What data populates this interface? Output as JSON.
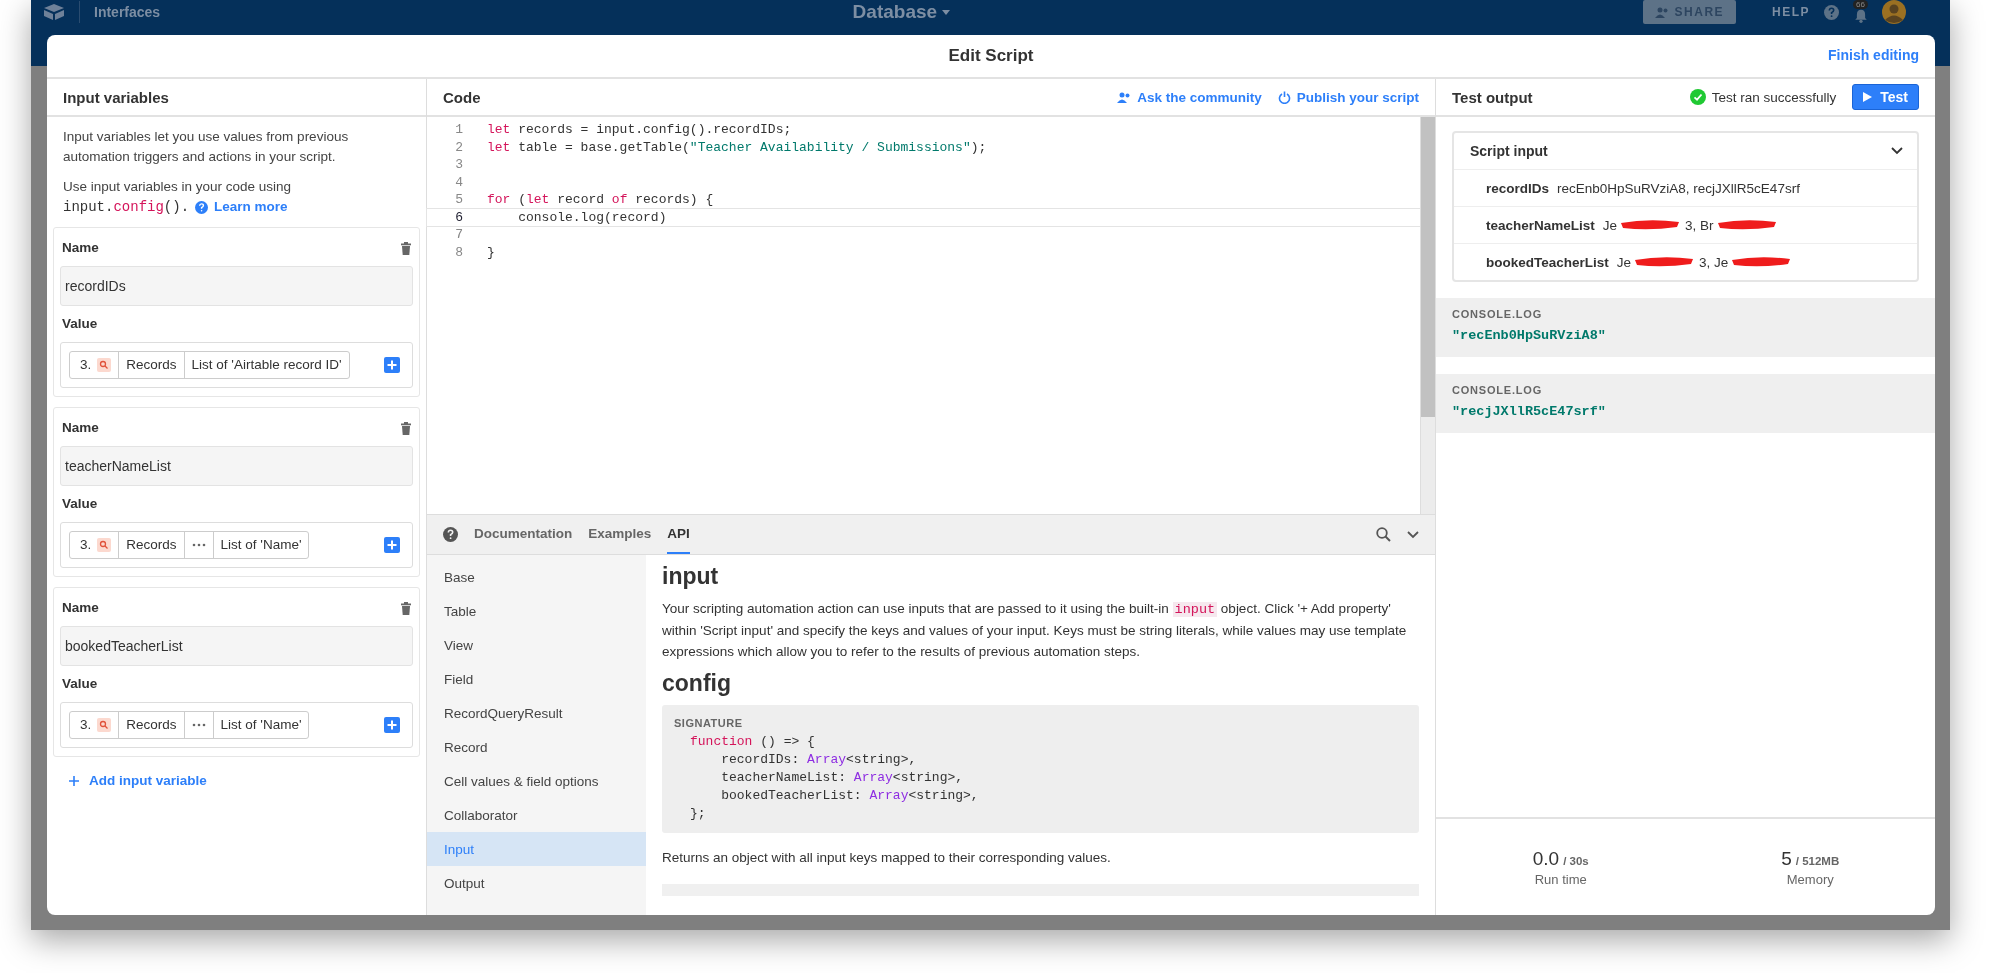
{
  "top_bar": {
    "left_label": "Interfaces",
    "title": "Database",
    "share": "SHARE",
    "help": "HELP",
    "notifications": "66"
  },
  "modal": {
    "title": "Edit Script",
    "finish": "Finish editing"
  },
  "input_panel": {
    "title": "Input variables",
    "intro": "Input variables let you use values from previous automation triggers and actions in your script.",
    "usage": {
      "text": "Use input variables in your code using",
      "code": [
        {
          "t": "input.",
          "kind": "plain"
        },
        {
          "t": "config",
          "kind": "kw"
        },
        {
          "t": "().",
          "kind": "plain"
        }
      ],
      "link": "Learn more"
    },
    "variables": [
      {
        "name_label": "Name",
        "name": "recordIDs",
        "value_label": "Value",
        "pills": [
          {
            "kind": "step",
            "text": "3."
          },
          {
            "kind": "text",
            "text": "Records"
          },
          {
            "kind": "text",
            "text": "List of 'Airtable record ID'"
          }
        ]
      },
      {
        "name_label": "Name",
        "name": "teacherNameList",
        "value_label": "Value",
        "pills": [
          {
            "kind": "step",
            "text": "3."
          },
          {
            "kind": "text",
            "text": "Records"
          },
          {
            "kind": "more"
          },
          {
            "kind": "text",
            "text": "List of 'Name'"
          }
        ]
      },
      {
        "name_label": "Name",
        "name": "bookedTeacherList",
        "value_label": "Value",
        "pills": [
          {
            "kind": "step",
            "text": "3."
          },
          {
            "kind": "text",
            "text": "Records"
          },
          {
            "kind": "more"
          },
          {
            "kind": "text",
            "text": "List of 'Name'"
          }
        ]
      }
    ],
    "add_variable": "Add input variable"
  },
  "code": {
    "title": "Code",
    "links": [
      "Ask the community",
      "Publish your script"
    ],
    "lines": [
      {
        "number": "1",
        "active": false,
        "tokens": [
          {
            "t": "let",
            "kind": "kw"
          },
          {
            "t": " records = input.config().recordIDs;",
            "kind": "plain"
          }
        ]
      },
      {
        "number": "2",
        "active": false,
        "tokens": [
          {
            "t": "let",
            "kind": "kw"
          },
          {
            "t": " table = base.getTable(",
            "kind": "plain"
          },
          {
            "t": "\"Teacher Availability / Submissions\"",
            "kind": "str"
          },
          {
            "t": ");",
            "kind": "plain"
          }
        ]
      },
      {
        "number": "3",
        "active": false
      },
      {
        "number": "4",
        "active": false
      },
      {
        "number": "5",
        "active": false,
        "tokens": [
          {
            "t": "for",
            "kind": "kw"
          },
          {
            "t": " (",
            "kind": "plain"
          },
          {
            "t": "let",
            "kind": "kw"
          },
          {
            "t": " record ",
            "kind": "plain"
          },
          {
            "t": "of",
            "kind": "kw"
          },
          {
            "t": " records) {",
            "kind": "plain"
          }
        ]
      },
      {
        "number": "6",
        "active": true,
        "tokens": [
          {
            "t": "    console.log(record)",
            "kind": "plain"
          }
        ]
      },
      {
        "number": "7",
        "active": false
      },
      {
        "number": "8",
        "active": false,
        "tokens": [
          {
            "t": "}",
            "kind": "plain"
          }
        ]
      }
    ]
  },
  "docs": {
    "tabs": [
      {
        "label": "Documentation",
        "selected": false
      },
      {
        "label": "Examples",
        "selected": false
      },
      {
        "label": "API",
        "selected": true
      }
    ],
    "nav": [
      {
        "label": "Base",
        "selected": false
      },
      {
        "label": "Table",
        "selected": false
      },
      {
        "label": "View",
        "selected": false
      },
      {
        "label": "Field",
        "selected": false
      },
      {
        "label": "RecordQueryResult",
        "selected": false
      },
      {
        "label": "Record",
        "selected": false
      },
      {
        "label": "Cell values & field options",
        "selected": false
      },
      {
        "label": "Collaborator",
        "selected": false
      },
      {
        "label": "Input",
        "selected": true
      },
      {
        "label": "Output",
        "selected": false
      }
    ],
    "heading": "input",
    "paragraph": {
      "before": "Your scripting automation action can use inputs that are passed to it using the built-in",
      "code": "input",
      "after": "object. Click '+ Add property' within 'Script input' and specify the keys and values of your input. Keys must be string literals, while values may use template expressions which allow you to refer to the results of previous automation steps."
    },
    "subheading": "config",
    "signature_label": "SIGNATURE",
    "signature_lines": [
      [
        {
          "t": "function",
          "kind": "kw"
        },
        {
          "t": " () => {",
          "kind": "plain"
        }
      ],
      [
        {
          "t": "    recordIDs: ",
          "kind": "plain"
        },
        {
          "t": "Array",
          "kind": "type"
        },
        {
          "t": "<string>,",
          "kind": "plain"
        }
      ],
      [
        {
          "t": "    teacherNameList: ",
          "kind": "plain"
        },
        {
          "t": "Array",
          "kind": "type"
        },
        {
          "t": "<string>,",
          "kind": "plain"
        }
      ],
      [
        {
          "t": "    bookedTeacherList: ",
          "kind": "plain"
        },
        {
          "t": "Array",
          "kind": "type"
        },
        {
          "t": "<string>,",
          "kind": "plain"
        }
      ],
      [
        {
          "t": "};",
          "kind": "plain"
        }
      ]
    ],
    "returns": "Returns an object with all input keys mapped to their corresponding values."
  },
  "test_output": {
    "title": "Test output",
    "status": "Test ran successfully",
    "test_button": "Test",
    "script_input": {
      "title": "Script input",
      "rows": [
        {
          "key": "recordIDs",
          "parts": [
            "recEnb0HpSuRVziA8, recjJXllR5cE47srf"
          ],
          "redacted": false
        },
        {
          "key": "teacherNameList",
          "parts": [
            "Je",
            "3, Br"
          ],
          "redacted": true
        },
        {
          "key": "bookedTeacherList",
          "parts": [
            "Je",
            "3, Je"
          ],
          "redacted": true
        }
      ]
    },
    "console": [
      {
        "label": "CONSOLE.LOG",
        "value": "\"recEnb0HpSuRVziA8\""
      },
      {
        "label": "CONSOLE.LOG",
        "value": "\"recjJXllR5cE47srf\""
      }
    ],
    "stats": [
      {
        "value": "0.0",
        "limit": "/ 30s",
        "label": "Run time"
      },
      {
        "value": "5",
        "limit": "/ 512MB",
        "label": "Memory"
      }
    ]
  }
}
